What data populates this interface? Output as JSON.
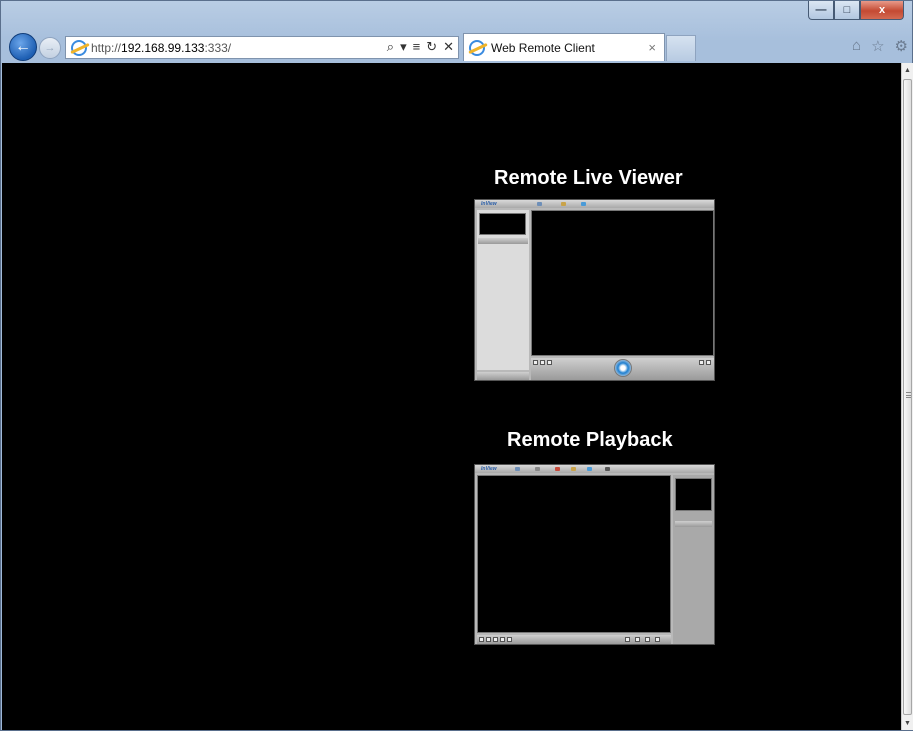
{
  "window": {
    "controls": {
      "minimize": "—",
      "maximize": "□",
      "close": "x"
    }
  },
  "navbar": {
    "back_icon": "←",
    "forward_icon": "→",
    "url_prefix": "http://",
    "url_host": "192.168.99.133",
    "url_suffix": ":333/",
    "address_tools": {
      "search": "⌕",
      "dropdown": "▾",
      "compat": "≡",
      "refresh": "↻",
      "stop": "✕"
    },
    "tab_title": "Web Remote Client",
    "tab_close": "×",
    "right_icons": {
      "home": "⌂",
      "favorites": "☆",
      "tools": "⚙"
    }
  },
  "content": {
    "live_viewer_title": "Remote Live Viewer",
    "playback_title": "Remote Playback",
    "thumbnail_logo": "InView"
  },
  "scrollbar": {
    "up": "▲",
    "down": "▼"
  }
}
